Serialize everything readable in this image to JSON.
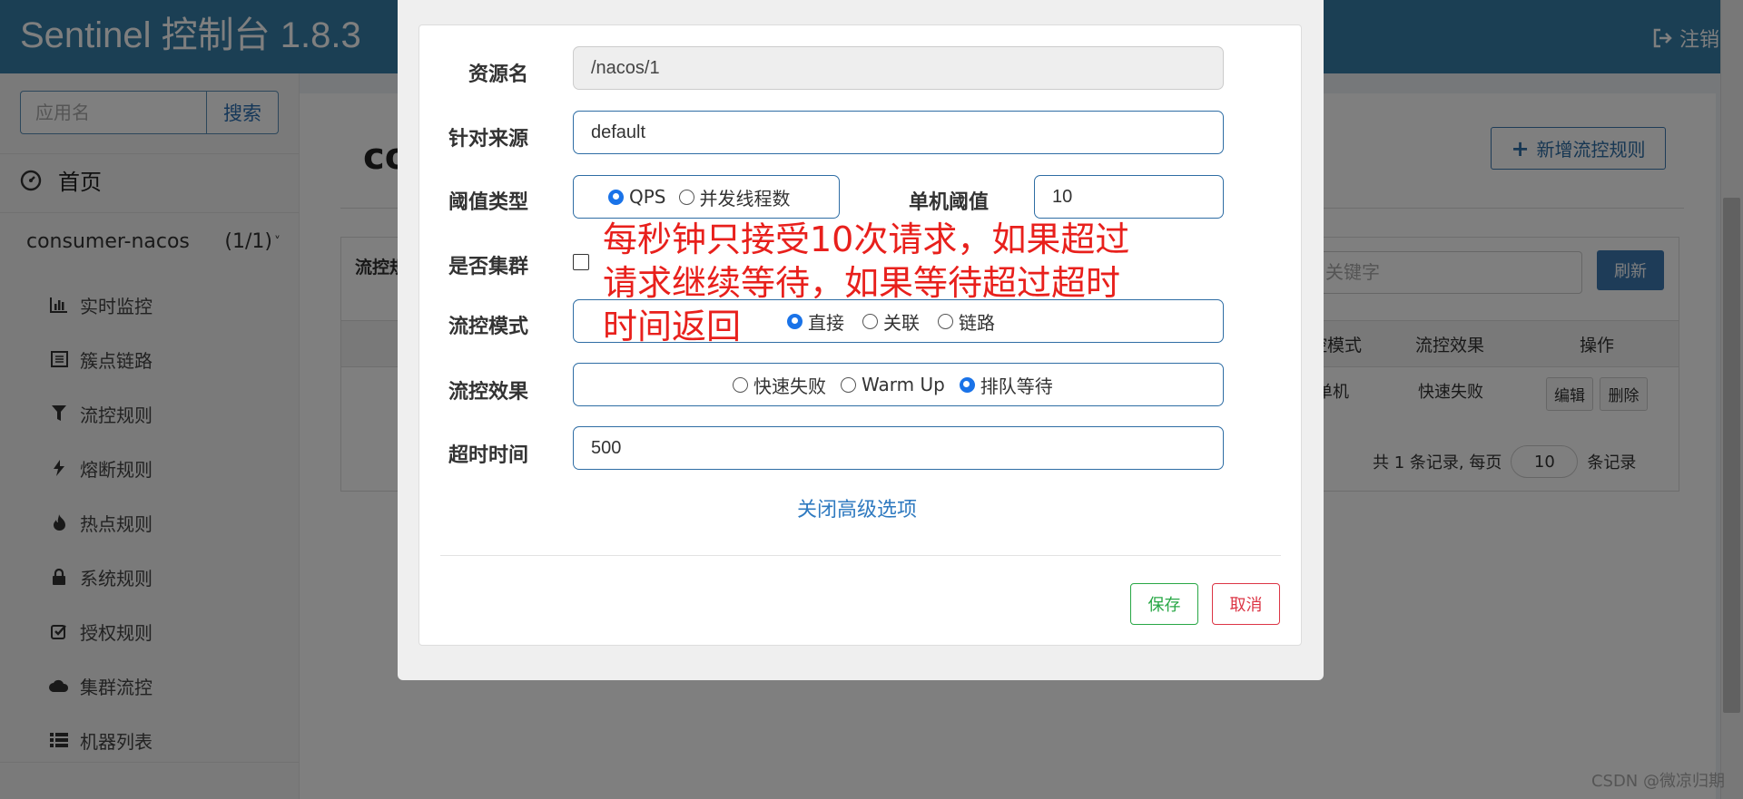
{
  "header": {
    "brand": "Sentinel 控制台 1.8.3",
    "logout": "注销"
  },
  "sidebar": {
    "search_placeholder": "应用名",
    "search_button": "搜索",
    "home": "首页",
    "app_name": "consumer-nacos",
    "app_count": "(1/1)",
    "items": [
      {
        "label": "实时监控",
        "icon": "bar-chart-icon"
      },
      {
        "label": "簇点链路",
        "icon": "list-alt-icon"
      },
      {
        "label": "流控规则",
        "icon": "filter-icon"
      },
      {
        "label": "熔断规则",
        "icon": "bolt-icon"
      },
      {
        "label": "热点规则",
        "icon": "fire-icon"
      },
      {
        "label": "系统规则",
        "icon": "lock-icon"
      },
      {
        "label": "授权规则",
        "icon": "check-square-icon"
      },
      {
        "label": "集群流控",
        "icon": "cloud-icon"
      },
      {
        "label": "机器列表",
        "icon": "list-icon"
      }
    ]
  },
  "main": {
    "title": "co",
    "add_button": "新增流控规则",
    "panel_title": "流控规",
    "keyword_placeholder": "关键字",
    "refresh": "刷新",
    "columns": [
      "控模式",
      "流控效果",
      "操作"
    ],
    "row": {
      "mode": "单机",
      "effect": "快速失败",
      "edit": "编辑",
      "delete": "删除"
    },
    "pager": {
      "prefix": "共 1 条记录, 每页",
      "page_size": "10",
      "suffix": "条记录"
    }
  },
  "modal": {
    "resource_label": "资源名",
    "resource_value": "/nacos/1",
    "source_label": "针对来源",
    "source_value": "default",
    "threshold_type_label": "阈值类型",
    "threshold_type_options": [
      "QPS",
      "并发线程数"
    ],
    "threshold_label": "单机阈值",
    "threshold_value": "10",
    "cluster_label": "是否集群",
    "mode_label": "流控模式",
    "mode_options": [
      "直接",
      "关联",
      "链路"
    ],
    "effect_label": "流控效果",
    "effect_options": [
      "快速失败",
      "Warm Up",
      "排队等待"
    ],
    "timeout_label": "超时时间",
    "timeout_value": "500",
    "advanced_toggle": "关闭高级选项",
    "save": "保存",
    "cancel": "取消"
  },
  "annotation": "每秒钟只接受10次请求，如果超过\n请求继续等待，如果等待超过超时\n时间返回",
  "watermark": "CSDN @微凉归期"
}
